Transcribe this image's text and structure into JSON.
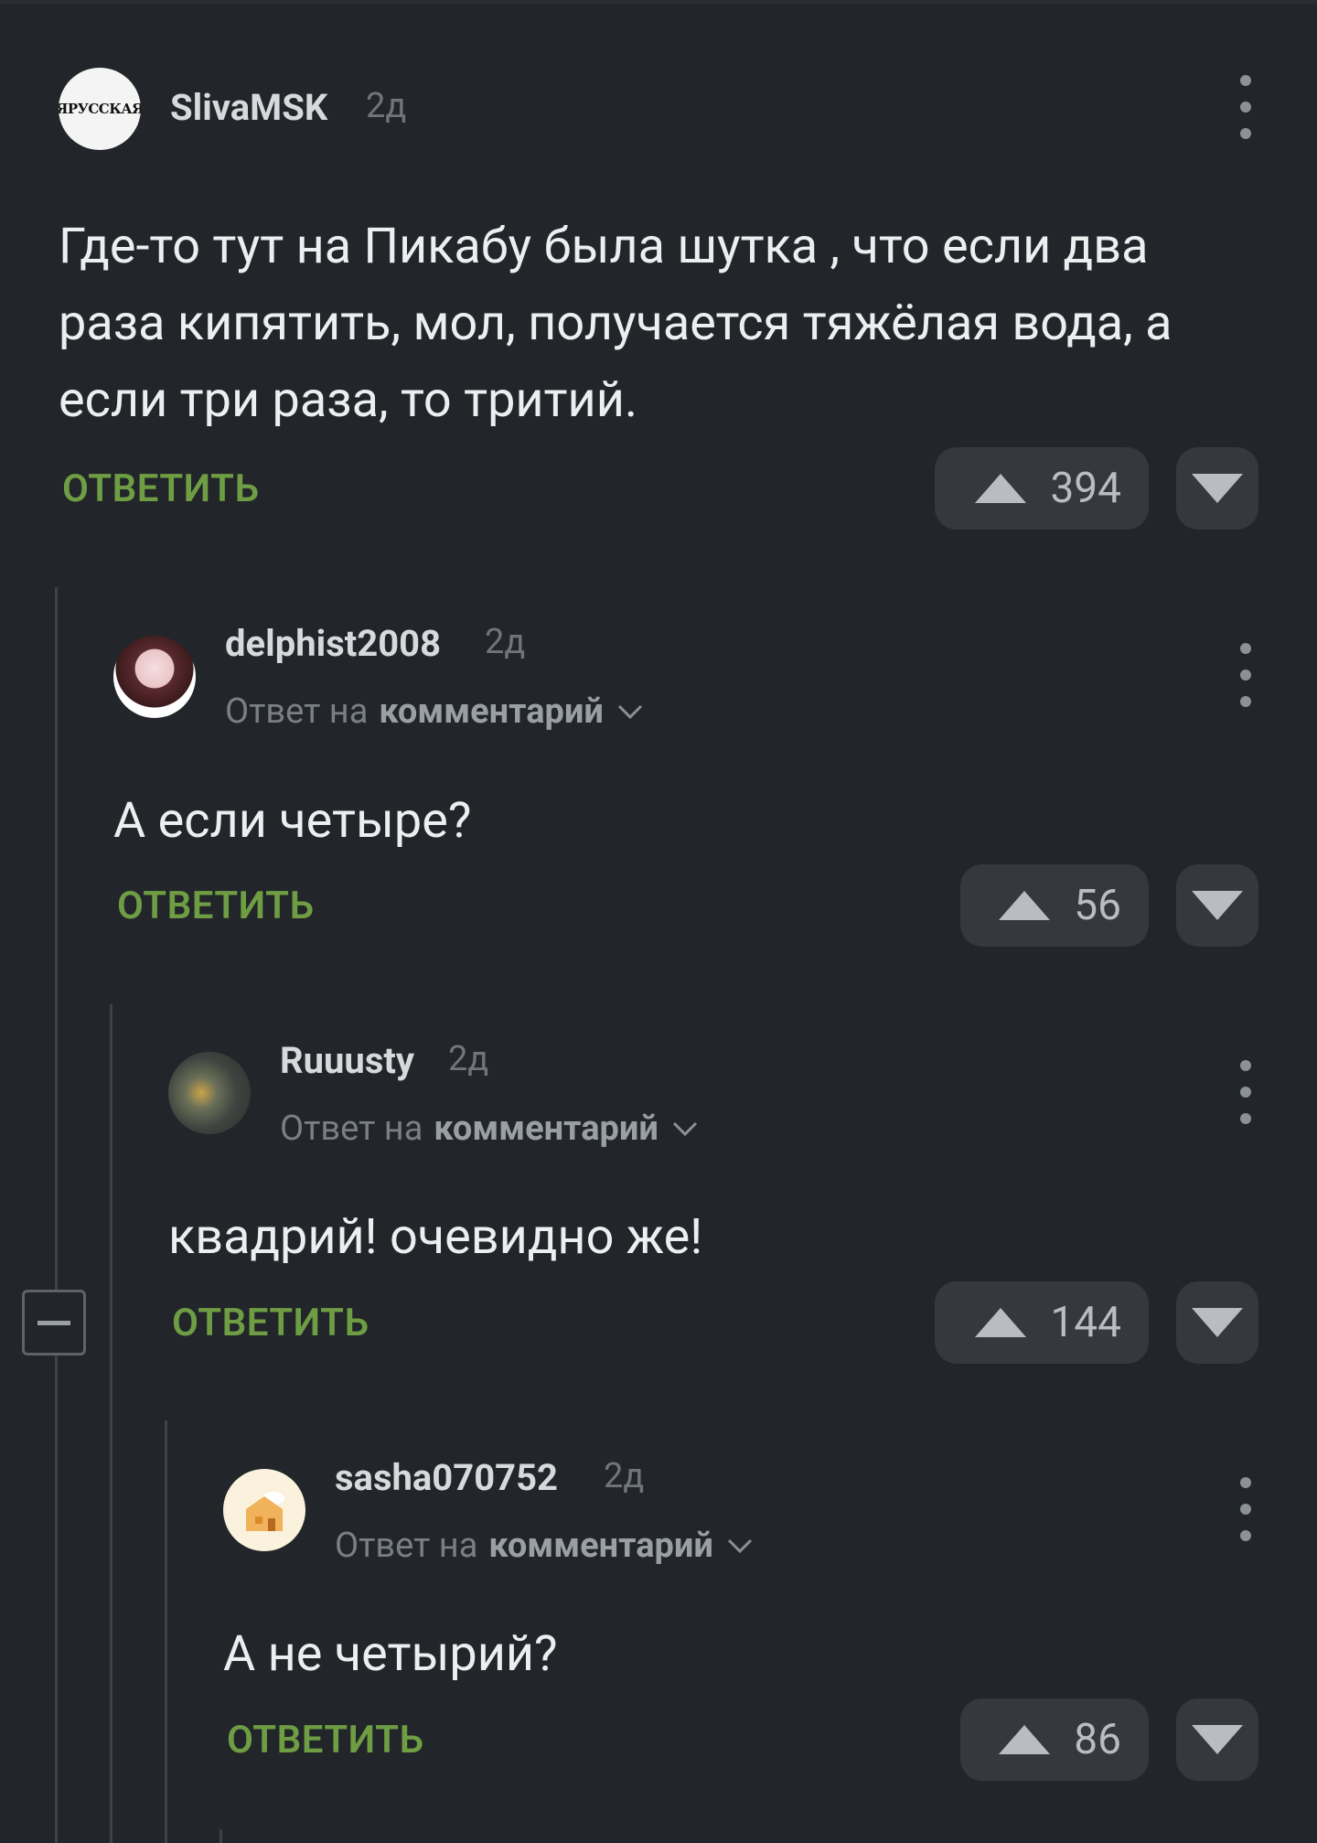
{
  "comments": [
    {
      "user": "SlivaMSK",
      "time": "2д",
      "avatar_label": "ЯРУССКАЯ",
      "text": "Где-то тут на Пикабу была шутка , что если два раза кипятить, мол, получается тяжёлая вода, а если три раза, то тритий.",
      "reply_label": "ОТВЕТИТЬ",
      "votes": "394"
    },
    {
      "user": "delphist2008",
      "time": "2д",
      "reply_prefix": "Ответ на",
      "reply_target": "комментарий",
      "text": "А если четыре?",
      "reply_label": "ОТВЕТИТЬ",
      "votes": "56"
    },
    {
      "user": "Ruuusty",
      "time": "2д",
      "reply_prefix": "Ответ на",
      "reply_target": "комментарий",
      "text": "квадрий! очевидно же!",
      "reply_label": "ОТВЕТИТЬ",
      "votes": "144"
    },
    {
      "user": "sasha070752",
      "time": "2д",
      "reply_prefix": "Ответ на",
      "reply_target": "комментарий",
      "text": "А не четырий?",
      "reply_label": "ОТВЕТИТЬ",
      "votes": "86"
    }
  ],
  "icons": {
    "more": "more-vertical-icon",
    "upvote": "triangle-up-icon",
    "downvote": "triangle-down-icon",
    "collapse": "minus-icon",
    "expand_reply": "chevron-down-icon"
  },
  "colors": {
    "background": "#222529",
    "reply_green": "#6e9d44",
    "pill": "#35383d",
    "thread_line": "#3e4247"
  }
}
